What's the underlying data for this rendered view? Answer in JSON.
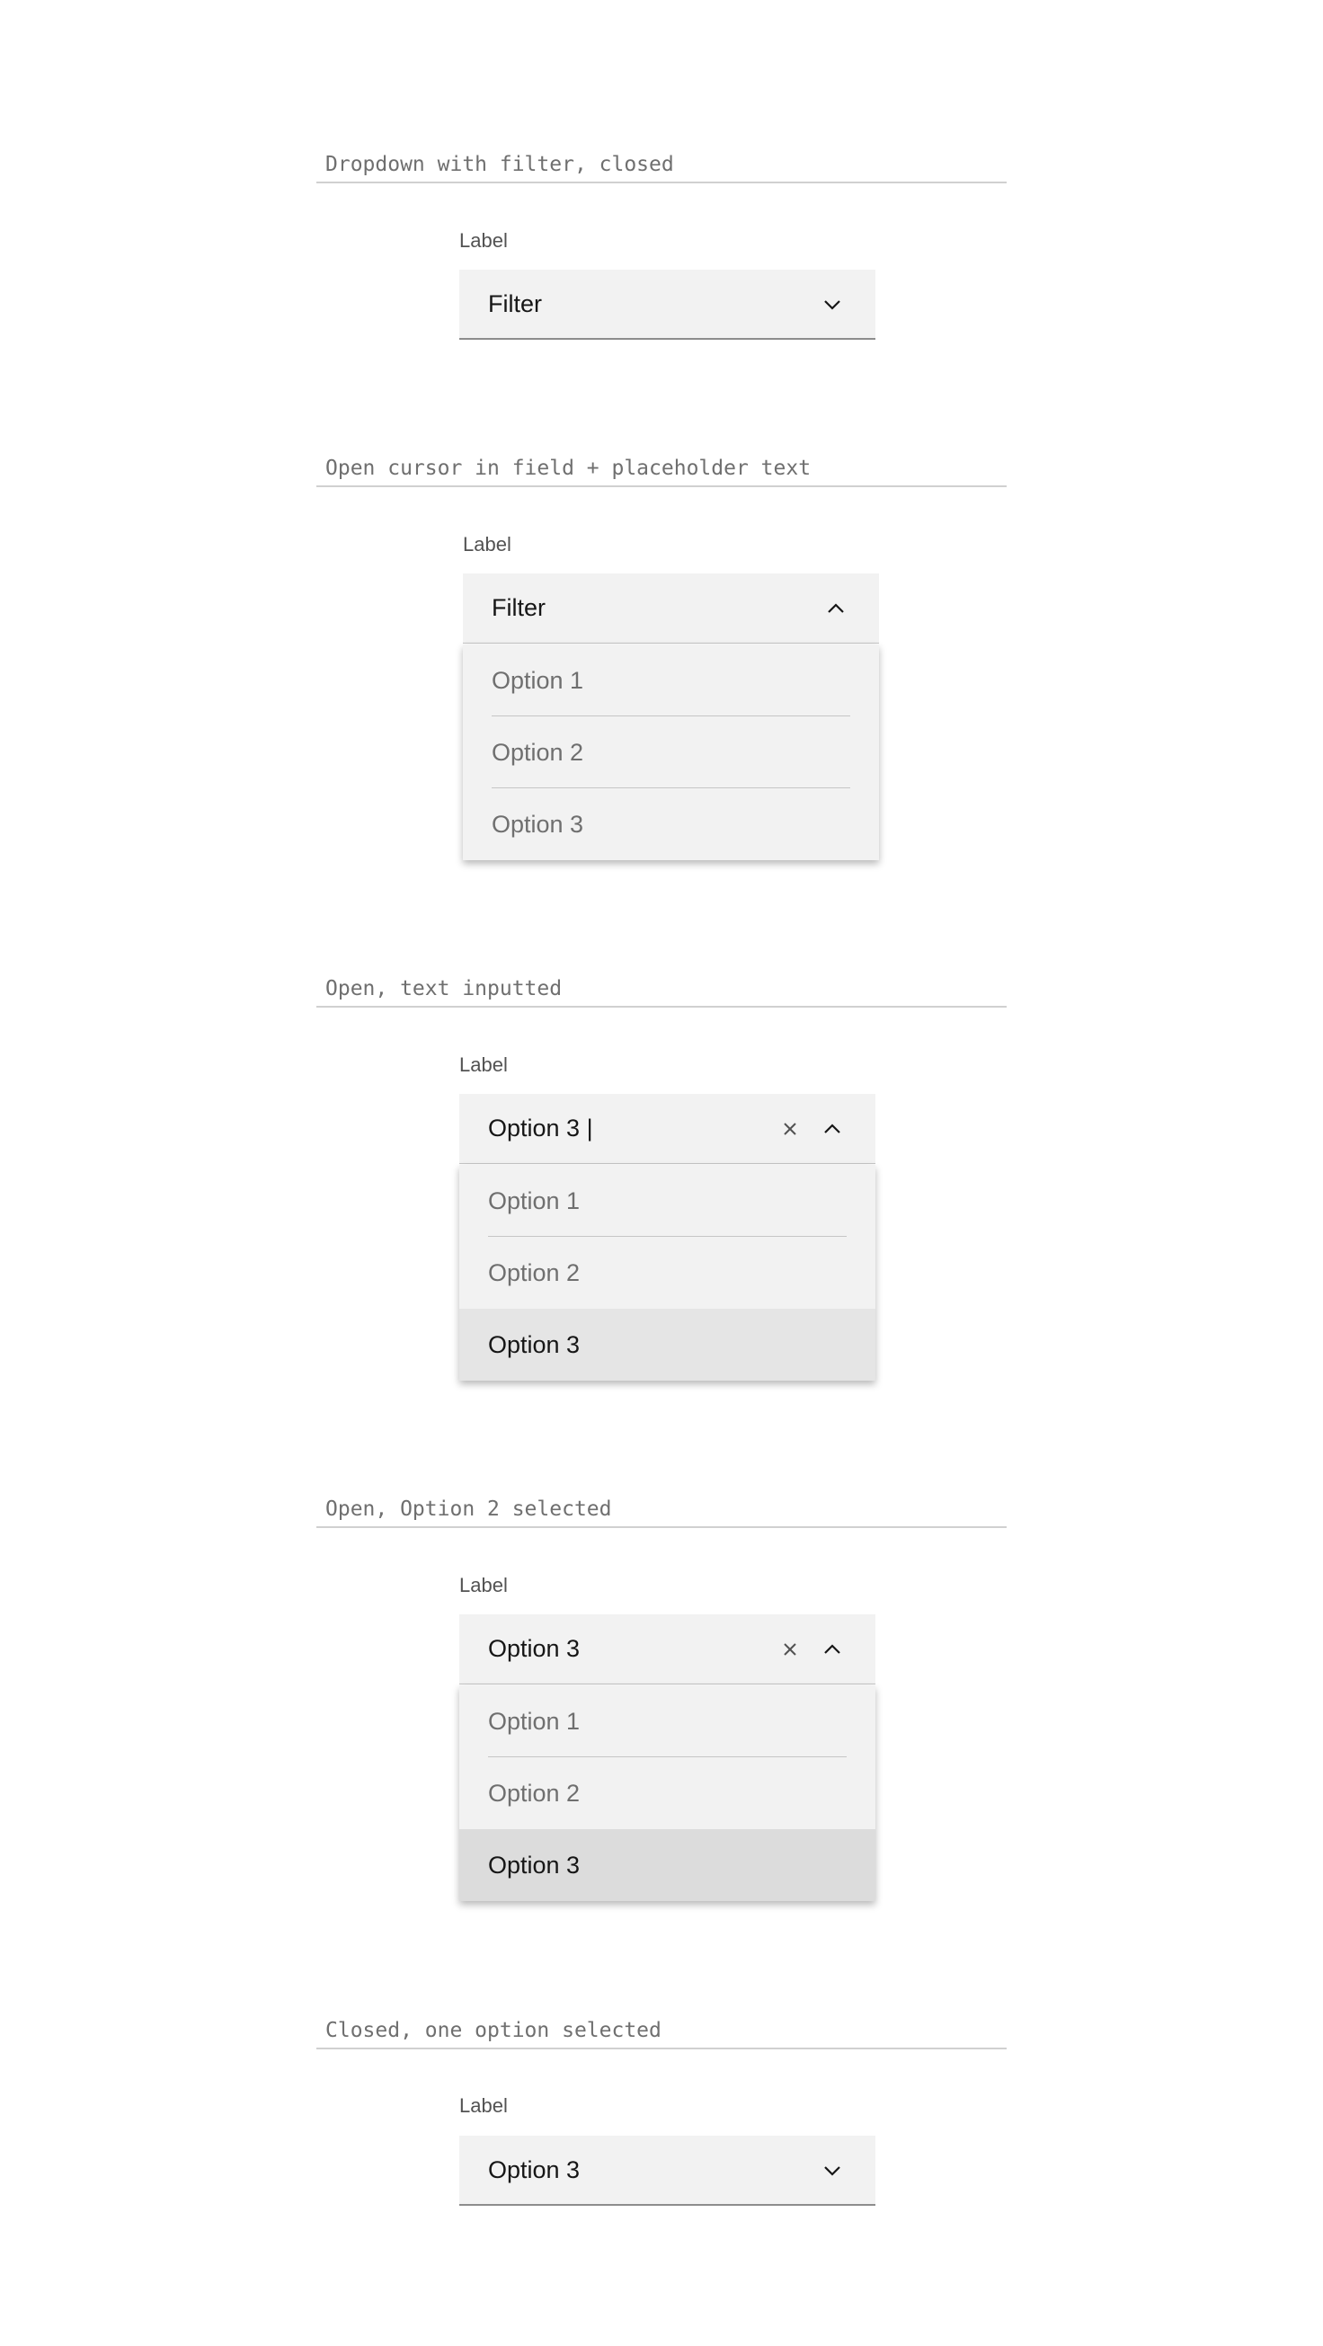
{
  "sections": [
    {
      "title": "Dropdown with filter, closed",
      "label": "Label",
      "value": "Filter"
    },
    {
      "title": "Open cursor in field + placeholder text",
      "label": "Label",
      "value": "Filter",
      "options": [
        "Option 1",
        "Option 2",
        "Option 3"
      ]
    },
    {
      "title": "Open, text inputted",
      "label": "Label",
      "value": "Option 3 |",
      "options": [
        "Option 1",
        "Option 2",
        "Option 3"
      ]
    },
    {
      "title": "Open, Option 2 selected",
      "label": "Label",
      "value": "Option 3",
      "options": [
        "Option 1",
        "Option 2",
        "Option 3"
      ]
    },
    {
      "title": "Closed, one option selected",
      "label": "Label",
      "value": "Option 3"
    }
  ],
  "icons": {
    "chevron_down": "chevron-down-icon",
    "chevron_up": "chevron-up-icon",
    "clear": "close-icon"
  },
  "colors": {
    "field_bg": "#f2f2f2",
    "hover_bg": "#e5e5e5",
    "selected_bg": "#dcdcdc",
    "text_primary": "#161616",
    "text_secondary": "#6f6f6f"
  }
}
